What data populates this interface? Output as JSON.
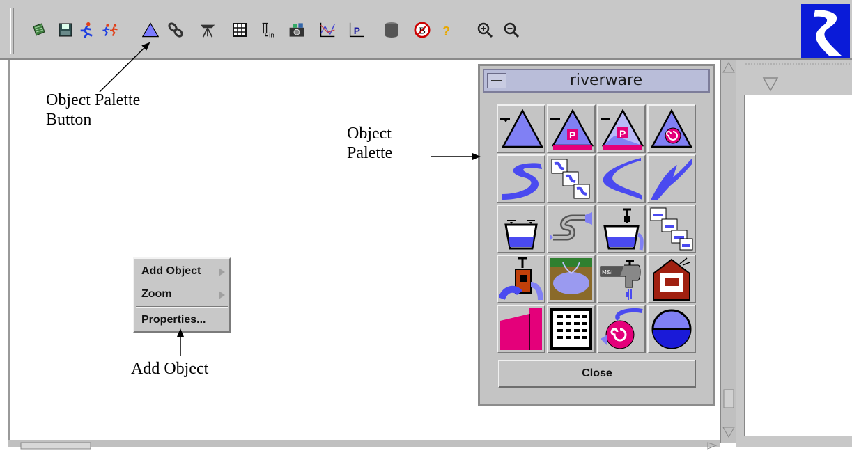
{
  "toolbar": {
    "buttons": [
      {
        "name": "open-icon",
        "color": "#2f6f2f"
      },
      {
        "name": "save-icon",
        "color": "#2f4f2f"
      },
      {
        "name": "run-icon",
        "color": "#e0401a"
      },
      {
        "name": "step-run-icon",
        "color": "#e0401a"
      },
      {
        "name": "object-palette-icon",
        "color": "#7b7bff"
      },
      {
        "name": "link-icon",
        "color": "#444444"
      },
      {
        "name": "telescope-icon",
        "color": "#444444"
      },
      {
        "name": "grid-icon",
        "color": "#333333"
      },
      {
        "name": "input-icon",
        "color": "#333333"
      },
      {
        "name": "camera-icon",
        "color": "#333333"
      },
      {
        "name": "plot-icon",
        "color": "#3b3bd0"
      },
      {
        "name": "policy-icon",
        "color": "#1a1aa0"
      },
      {
        "name": "database-icon",
        "color": "#555555"
      },
      {
        "name": "stop-icon",
        "color": "#cc0000"
      },
      {
        "name": "help-icon",
        "color": "#e8a800"
      },
      {
        "name": "zoom-in-icon",
        "color": "#333333"
      },
      {
        "name": "zoom-out-icon",
        "color": "#333333"
      }
    ]
  },
  "palette": {
    "title": "riverware",
    "close_label": "Close",
    "objects": [
      "storage-reservoir-icon",
      "level-power-reservoir-icon",
      "slope-power-reservoir-icon",
      "pumped-storage-icon",
      "reach-icon",
      "aggregate-reach-icon",
      "confluence-icon",
      "bifurcation-icon",
      "canal-icon",
      "pipeline-icon",
      "diversion-icon",
      "aggregate-diversion-icon",
      "distribution-canal-icon",
      "groundwater-storage-icon",
      "water-user-icon",
      "thermal-icon",
      "stream-gage-icon",
      "data-object-icon",
      "pump-icon",
      "inline-pump-icon"
    ]
  },
  "context_menu": {
    "items": [
      "Add Object",
      "Zoom",
      "Properties..."
    ]
  },
  "annotations": {
    "object_palette_button": "Object Palette\nButton",
    "object_palette": "Object\nPalette",
    "add_object": "Add Object"
  },
  "colors": {
    "water_blue": "#7b7bf0",
    "power_magenta": "#d4006e",
    "logo_blue": "#0a1bd8"
  }
}
